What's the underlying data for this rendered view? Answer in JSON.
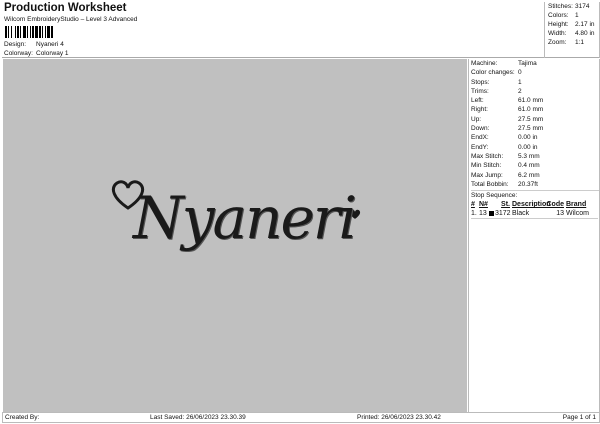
{
  "header": {
    "title": "Production Worksheet",
    "subtitle": "Wilcom EmbroideryStudio – Level 3 Advanced",
    "design_label": "Design:",
    "design_value": "Nyaneri 4",
    "colorway_label": "Colorway:",
    "colorway_value": "Colorway 1"
  },
  "summary": [
    {
      "k": "Stitches:",
      "v": "3174"
    },
    {
      "k": "Colors:",
      "v": "1"
    },
    {
      "k": "Height:",
      "v": "2.17 in"
    },
    {
      "k": "Width:",
      "v": "4.80 in"
    },
    {
      "k": "Zoom:",
      "v": "1:1"
    }
  ],
  "design": {
    "text": "Nyaneri",
    "thread_color": "#1a1a1a",
    "background": "#c0c0c0"
  },
  "details": [
    {
      "k": "Machine:",
      "v": "Tajima"
    },
    {
      "k": "Color changes:",
      "v": "0"
    },
    {
      "k": "Stops:",
      "v": "1"
    },
    {
      "k": "Trims:",
      "v": "2"
    },
    {
      "k": "Left:",
      "v": "61.0 mm"
    },
    {
      "k": "Right:",
      "v": "61.0 mm"
    },
    {
      "k": "Up:",
      "v": "27.5 mm"
    },
    {
      "k": "Down:",
      "v": "27.5 mm"
    },
    {
      "k": "EndX:",
      "v": "0.00 in"
    },
    {
      "k": "EndY:",
      "v": "0.00 in"
    },
    {
      "k": "Max Stitch:",
      "v": "5.3 mm"
    },
    {
      "k": "Min Stitch:",
      "v": "0.4 mm"
    },
    {
      "k": "Max Jump:",
      "v": "6.2 mm"
    },
    {
      "k": "Total Bobbin:",
      "v": "20.37ft"
    }
  ],
  "stop_sequence": {
    "title": "Stop Sequence:",
    "columns": [
      "#",
      "N#",
      "St.",
      "Description",
      "Code",
      "Brand"
    ],
    "rows": [
      {
        "idx": "1.",
        "n": "13",
        "swatch": "#000000",
        "st": "3172",
        "desc": "Black",
        "code": "13",
        "brand": "Wilcom"
      }
    ]
  },
  "footer": {
    "created_by": "Created By:",
    "last_saved": "Last Saved: 26/06/2023 23.30.39",
    "printed": "Printed: 26/06/2023 23.30.42",
    "page": "Page 1 of 1"
  }
}
